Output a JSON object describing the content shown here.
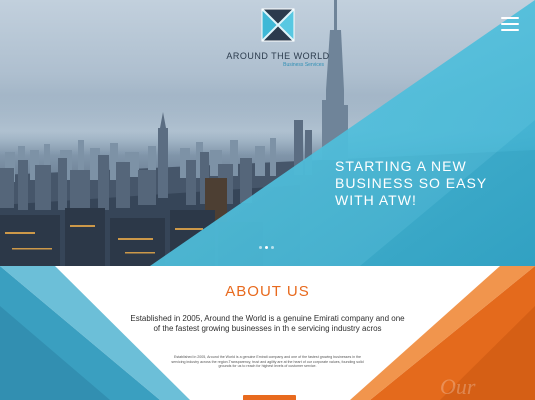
{
  "brand": {
    "name": "AROUND THE WORLD",
    "tagline": "Business Services",
    "colors": {
      "teal": "#3fb8d6",
      "orange": "#e86a1e",
      "navy": "#2b3b4d"
    },
    "logo_icon": "diamond-x-logo-icon"
  },
  "header": {
    "menu_icon": "hamburger-menu-icon"
  },
  "hero": {
    "headline_lines": [
      "STARTING A NEW",
      "BUSINESS  SO EASY",
      "WITH ATW!"
    ],
    "slide_count": 3,
    "active_slide": 2
  },
  "about": {
    "title": "ABOUT US",
    "lead": "Established in 2005, Around the World is a genuine Emirati company and one of the fastest growing businesses in th e servicing industry acros",
    "body": "Established in 2005, Around the World is a genuine Emirati company and one of the fastest growing businesses in the servicing industry across the region.Transparency, trust and agility are at the heart of our corporate values, founding solid grounds for us to reach for highest levels of customer service."
  }
}
